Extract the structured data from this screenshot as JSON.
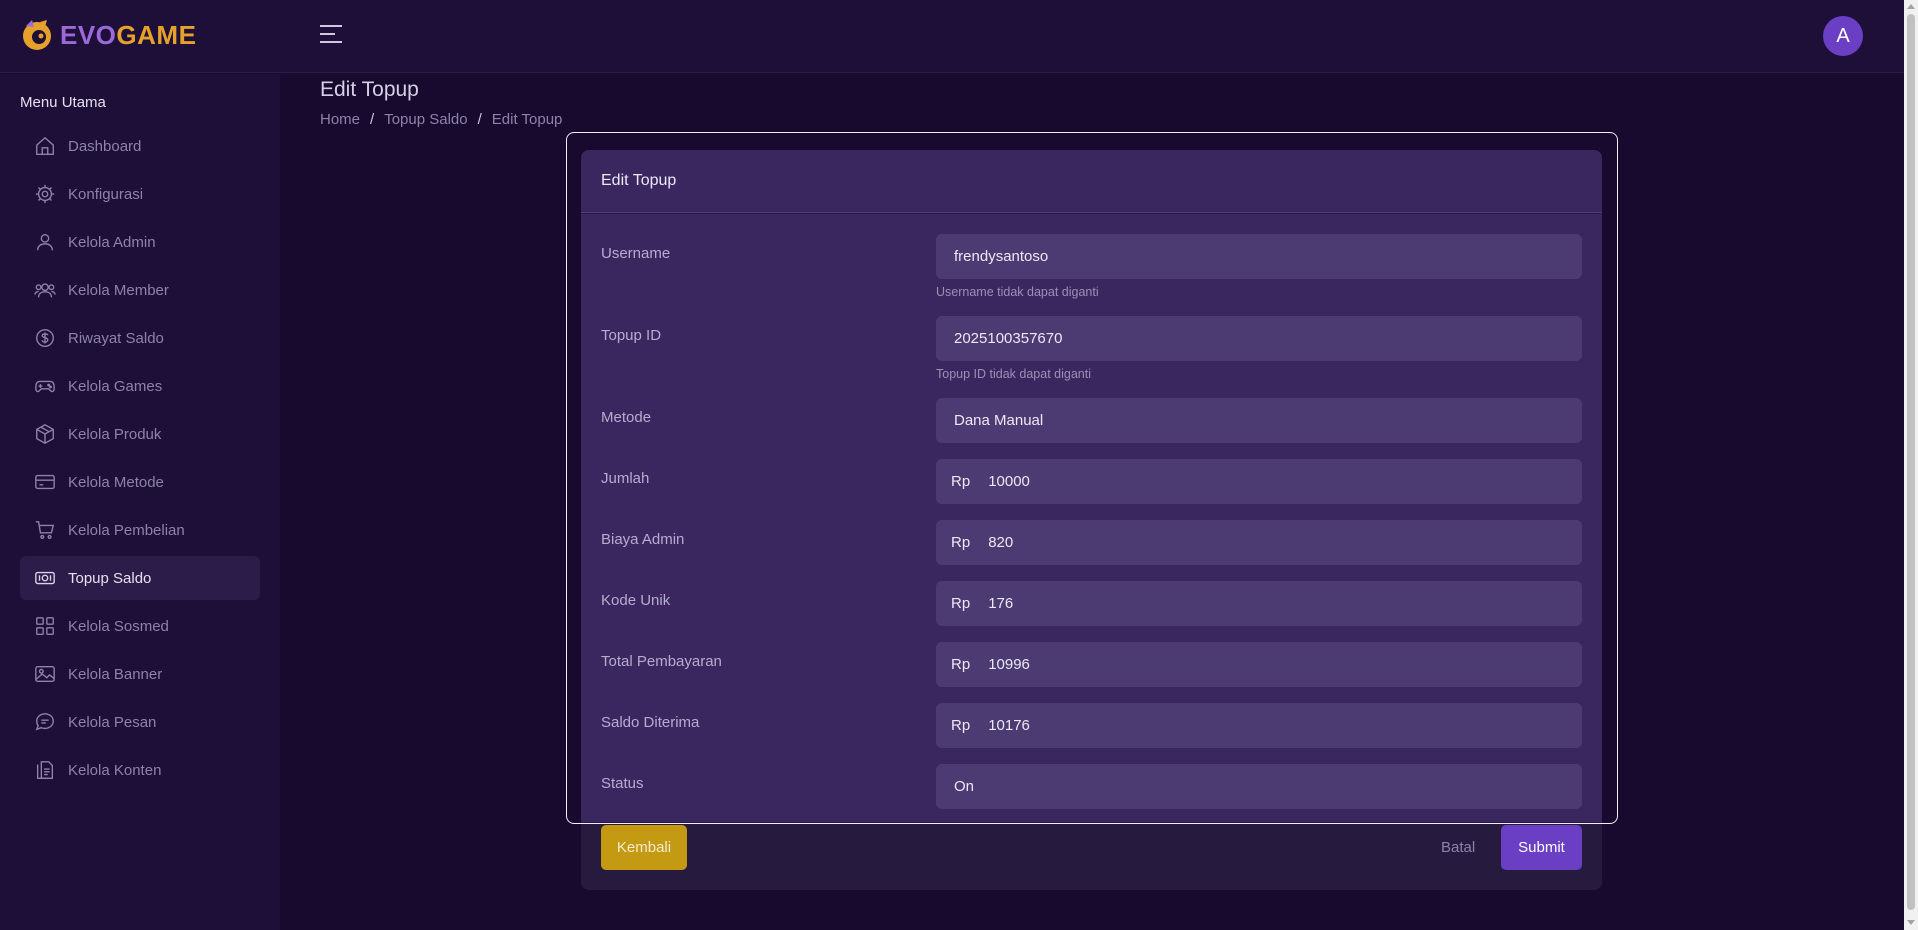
{
  "brand": {
    "name_part1": "EVO",
    "name_part2": "GAME",
    "logo_icon": "evogame-logo-icon"
  },
  "header": {
    "menu_icon": "hamburger-icon",
    "avatar_initial": "A"
  },
  "sidebar": {
    "title": "Menu Utama",
    "items": [
      {
        "label": "Dashboard",
        "icon": "home-icon"
      },
      {
        "label": "Konfigurasi",
        "icon": "gear-icon"
      },
      {
        "label": "Kelola Admin",
        "icon": "user-icon"
      },
      {
        "label": "Kelola Member",
        "icon": "users-icon"
      },
      {
        "label": "Riwayat Saldo",
        "icon": "dollar-circle-icon"
      },
      {
        "label": "Kelola Games",
        "icon": "gamepad-icon"
      },
      {
        "label": "Kelola Produk",
        "icon": "box-icon"
      },
      {
        "label": "Kelola Metode",
        "icon": "credit-card-icon"
      },
      {
        "label": "Kelola Pembelian",
        "icon": "cart-icon"
      },
      {
        "label": "Topup Saldo",
        "icon": "money-icon",
        "active": true
      },
      {
        "label": "Kelola Sosmed",
        "icon": "grid-icon"
      },
      {
        "label": "Kelola Banner",
        "icon": "image-icon"
      },
      {
        "label": "Kelola Pesan",
        "icon": "chat-icon"
      },
      {
        "label": "Kelola Konten",
        "icon": "document-icon"
      }
    ]
  },
  "page": {
    "title": "Edit Topup",
    "breadcrumb": [
      "Home",
      "Topup Saldo",
      "Edit Topup"
    ],
    "breadcrumb_sep": "/"
  },
  "form": {
    "title": "Edit Topup",
    "currency_prefix": "Rp",
    "fields": {
      "username": {
        "label": "Username",
        "value": "frendysantoso",
        "hint": "Username tidak dapat diganti"
      },
      "topup_id": {
        "label": "Topup ID",
        "value": "2025100357670",
        "hint": "Topup ID tidak dapat diganti"
      },
      "metode": {
        "label": "Metode",
        "value": "Dana Manual"
      },
      "jumlah": {
        "label": "Jumlah",
        "value": "10000"
      },
      "biaya_admin": {
        "label": "Biaya Admin",
        "value": "820"
      },
      "kode_unik": {
        "label": "Kode Unik",
        "value": "176"
      },
      "total_pembayaran": {
        "label": "Total Pembayaran",
        "value": "10996"
      },
      "saldo_diterima": {
        "label": "Saldo Diterima",
        "value": "10176"
      },
      "status": {
        "label": "Status",
        "value": "On"
      }
    },
    "buttons": {
      "back": "Kembali",
      "cancel": "Batal",
      "submit": "Submit"
    }
  },
  "colors": {
    "accent": "#6a3fc4",
    "brand_gold": "#e6a12b",
    "back_button": "#c39a12",
    "background": "#170a2e"
  }
}
